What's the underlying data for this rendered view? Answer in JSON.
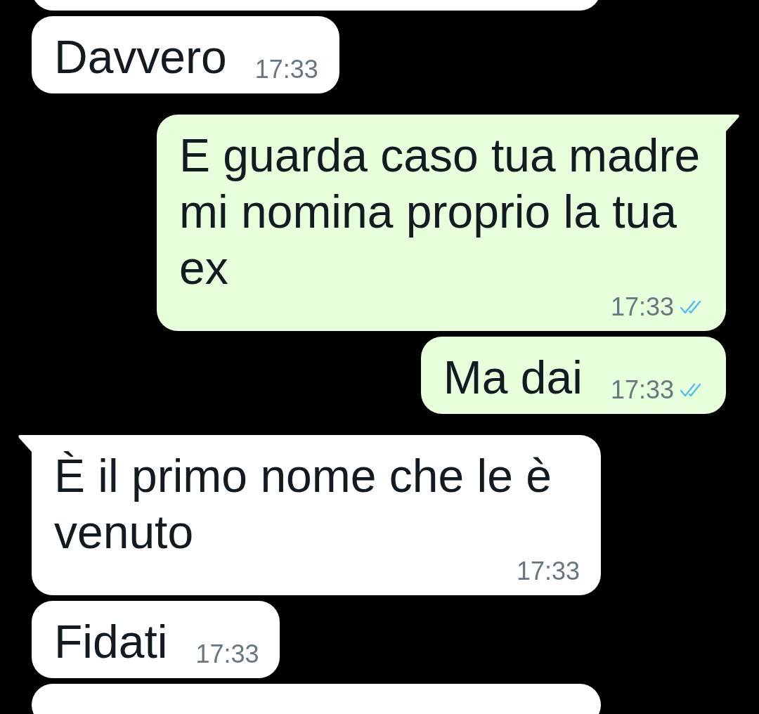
{
  "cut_top_bubble": {
    "kind": "incoming"
  },
  "messages": [
    {
      "kind": "incoming",
      "tail": false,
      "text": "Davvero",
      "time": "17:33"
    },
    {
      "kind": "outgoing",
      "tail": true,
      "text": "E guarda caso tua madre mi nomina proprio la tua ex",
      "time": "17:33",
      "read": true
    },
    {
      "kind": "outgoing",
      "tail": false,
      "text": "Ma dai",
      "time": "17:33",
      "read": true
    },
    {
      "kind": "incoming",
      "tail": true,
      "text": "È il primo nome che le è venuto",
      "time": "17:33"
    },
    {
      "kind": "incoming",
      "tail": false,
      "text": "Fidati",
      "time": "17:33"
    }
  ],
  "cut_bottom_bubble": {
    "kind": "incoming"
  }
}
